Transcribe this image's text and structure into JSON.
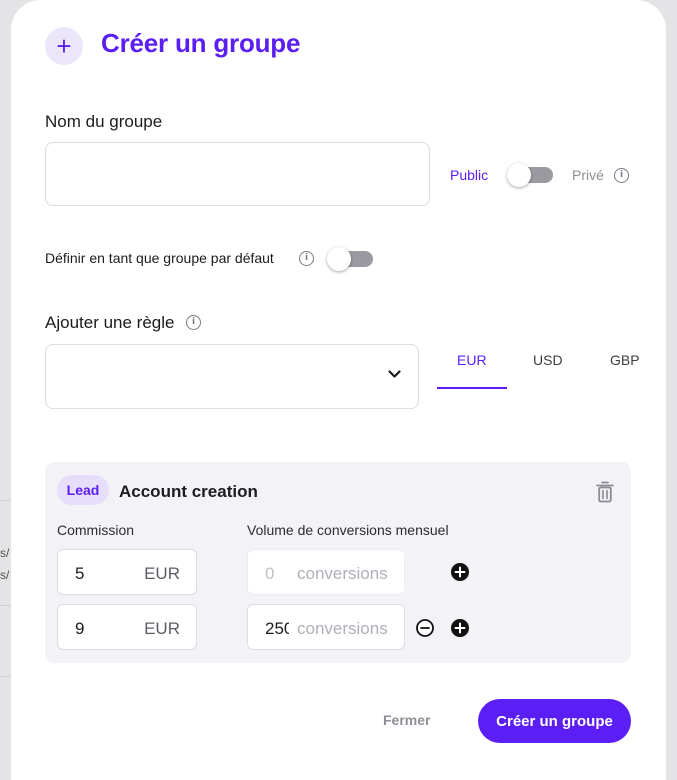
{
  "background": {
    "fragments": [
      "s/",
      "s/"
    ]
  },
  "modal": {
    "title": "Créer un groupe",
    "header_icon": "plus-icon",
    "group_name": {
      "label": "Nom du groupe",
      "value": "",
      "placeholder": ""
    },
    "visibility": {
      "public_label": "Public",
      "private_label": "Privé",
      "selected": "Public",
      "info_icon": "info-icon"
    },
    "default_group": {
      "label": "Définir en tant que groupe par défaut",
      "enabled": false
    },
    "add_rule": {
      "label": "Ajouter une règle",
      "selected": ""
    },
    "currency_tabs": [
      {
        "label": "EUR",
        "active": true
      },
      {
        "label": "USD",
        "active": false
      },
      {
        "label": "GBP",
        "active": false
      }
    ],
    "rule": {
      "badge": "Lead",
      "name": "Account creation",
      "commission_header": "Commission",
      "volume_header": "Volume de conversions mensuel",
      "tiers": [
        {
          "commission": "5",
          "commission_unit": "EUR",
          "volume": "",
          "volume_placeholder": "0",
          "volume_unit": "conversions"
        },
        {
          "commission": "9",
          "commission_unit": "EUR",
          "volume": "250",
          "volume_placeholder": "",
          "volume_unit": "conversions"
        }
      ]
    },
    "footer": {
      "cancel_label": "Fermer",
      "submit_label": "Créer un groupe"
    }
  },
  "colors": {
    "accent": "#5b1ef5",
    "badge_bg": "#e6defb",
    "card_bg": "#f2f2f7"
  }
}
